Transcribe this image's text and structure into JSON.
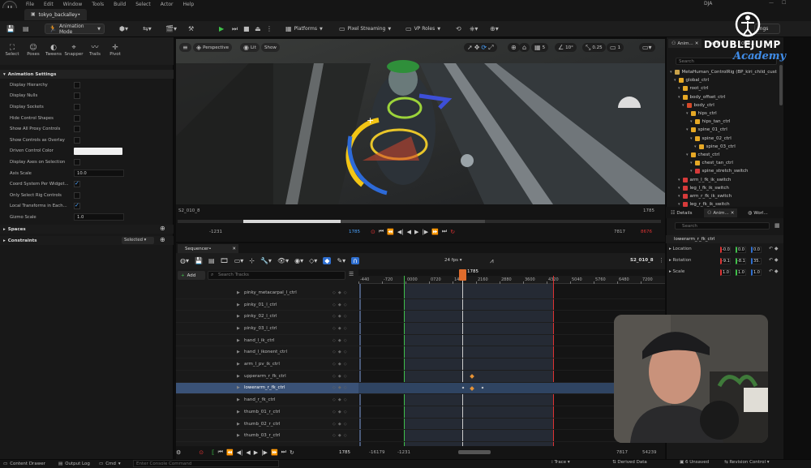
{
  "app": {
    "menus": [
      "File",
      "Edit",
      "Window",
      "Tools",
      "Build",
      "Select",
      "Actor",
      "Help"
    ],
    "user": "DJA",
    "doc_tab": "tokyo_backalley•"
  },
  "toolbar": {
    "mode": "Animation Mode",
    "platforms": "Platforms",
    "pixel_streaming": "Pixel Streaming",
    "vp_roles": "VP Roles",
    "settings": "ings"
  },
  "left": {
    "modes": [
      "Select",
      "Poses",
      "Tweens",
      "Snapper",
      "Trails",
      "Pivot"
    ],
    "section": "Animation Settings",
    "props": [
      {
        "label": "Display Hierarchy",
        "type": "cb",
        "on": false
      },
      {
        "label": "Display Nulls",
        "type": "cb",
        "on": false
      },
      {
        "label": "Display Sockets",
        "type": "cb",
        "on": false
      },
      {
        "label": "Hide Control Shapes",
        "type": "cb",
        "on": false
      },
      {
        "label": "Show All Proxy Controls",
        "type": "cb",
        "on": false
      },
      {
        "label": "Show Controls as Overlay",
        "type": "cb",
        "on": false
      },
      {
        "label": "Driven Control Color",
        "type": "color"
      },
      {
        "label": "Display Axes on Selection",
        "type": "cb",
        "on": false
      },
      {
        "label": "Axis Scale",
        "type": "val",
        "value": "10.0"
      },
      {
        "label": "Coord System Per Widget...",
        "type": "cb",
        "on": true
      },
      {
        "label": "Only Select Rig Controls",
        "type": "cb",
        "on": false
      },
      {
        "label": "Local Transforms in Each...",
        "type": "cb",
        "on": true
      },
      {
        "label": "Gizmo Scale",
        "type": "val",
        "value": "1.0"
      }
    ],
    "spaces": "Spaces",
    "constraints": "Constraints",
    "constraints_filter": "Selected"
  },
  "viewport": {
    "perspective": "Perspective",
    "lit": "Lit",
    "show": "Show",
    "grid": "5",
    "angle": "10°",
    "scale": "0.25",
    "cams": "1"
  },
  "scrub": {
    "shot": "S2_010_8",
    "end": "1785",
    "left": "-1231",
    "current": "1785",
    "right": "7817",
    "right2": "8676"
  },
  "sequencer": {
    "tab": "Sequencer•",
    "fps": "24 fps",
    "shot": "S2_010_8",
    "add": "Add",
    "search": "Search Tracks",
    "current": "1785",
    "ruler": [
      "-440",
      "-720",
      "0000",
      "0720",
      "1440",
      "2160",
      "2880",
      "3600",
      "4320",
      "5040",
      "5760",
      "6480",
      "7200"
    ],
    "tracks": [
      "pinky_metacarpal_l_ctrl",
      "pinky_01_l_ctrl",
      "pinky_02_l_ctrl",
      "pinky_03_l_ctrl",
      "hand_l_ik_ctrl",
      "hand_l_ikonent_ctrl",
      "arm_l_pv_ik_ctrl",
      "upperarm_r_fk_ctrl",
      "lowerarm_r_fk_ctrl",
      "hand_r_fk_ctrl",
      "thumb_01_r_ctrl",
      "thumb_02_r_ctrl",
      "thumb_03_r_ctrl"
    ],
    "selected_index": 8,
    "bottom": {
      "current": "1785",
      "left": "-16179",
      "left2": "-1231",
      "right": "7817",
      "right2": "54239"
    }
  },
  "right": {
    "tabs": [
      "Anim...",
      "Levels",
      "Outl..."
    ],
    "search": "Search",
    "outliner": [
      {
        "label": "MetaHuman_ControlRig (BP_kiri_child_cust",
        "depth": 0,
        "color": "#c9a24a"
      },
      {
        "label": "global_ctrl",
        "depth": 1,
        "color": "#e6a825"
      },
      {
        "label": "root_ctrl",
        "depth": 2,
        "color": "#e6a825"
      },
      {
        "label": "body_offset_ctrl",
        "depth": 2,
        "color": "#e6a825"
      },
      {
        "label": "body_ctrl",
        "depth": 3,
        "color": "#d64a2a"
      },
      {
        "label": "hips_ctrl",
        "depth": 4,
        "color": "#e6a825"
      },
      {
        "label": "hips_tan_ctrl",
        "depth": 5,
        "color": "#e6a825"
      },
      {
        "label": "spine_01_ctrl",
        "depth": 4,
        "color": "#e6a825"
      },
      {
        "label": "spine_02_ctrl",
        "depth": 5,
        "color": "#e6a825"
      },
      {
        "label": "spine_03_ctrl",
        "depth": 6,
        "color": "#e6a825"
      },
      {
        "label": "chest_ctrl",
        "depth": 4,
        "color": "#e6a825"
      },
      {
        "label": "chest_tan_ctrl",
        "depth": 5,
        "color": "#e6a825"
      },
      {
        "label": "spine_stretch_switch",
        "depth": 5,
        "color": "#d63a3a"
      },
      {
        "label": "arm_l_fk_ik_switch",
        "depth": 2,
        "color": "#d63a3a"
      },
      {
        "label": "leg_l_fk_ik_switch",
        "depth": 2,
        "color": "#d63a3a"
      },
      {
        "label": "arm_r_fk_ik_switch",
        "depth": 2,
        "color": "#d63a3a"
      },
      {
        "label": "leg_r_fk_ik_switch",
        "depth": 2,
        "color": "#d63a3a"
      }
    ],
    "details_tabs": [
      "Details",
      "Anim...",
      "Worl..."
    ],
    "details_search": "Search",
    "details_obj": "lowerarm_r_fk_ctrl",
    "location": {
      "label": "Location",
      "x": "-0.0",
      "y": "0.0",
      "z": "0.0"
    },
    "rotation": {
      "label": "Rotation",
      "x": "-9.1",
      "y": "-8.1",
      "z": "35."
    },
    "scale": {
      "label": "Scale",
      "x": "1.0",
      "y": "1.0",
      "z": "1.0"
    }
  },
  "status": {
    "content_drawer": "Content Drawer",
    "output_log": "Output Log",
    "cmd": "Cmd",
    "console": "Enter Console Command",
    "trace": "Trace",
    "derived": "Derived Data",
    "unsaved": "6 Unsaved",
    "revision": "Revision Control"
  },
  "brand": {
    "line1": "DOUBLEJUMP",
    "line2": "Academy"
  }
}
